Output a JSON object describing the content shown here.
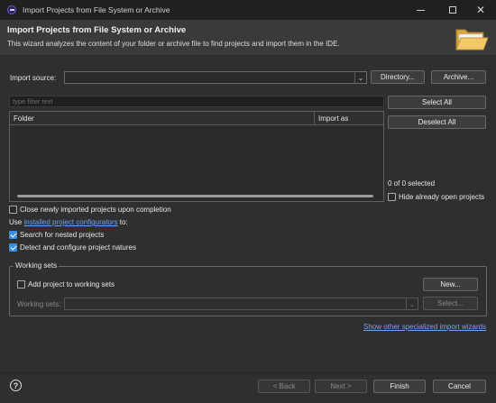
{
  "window": {
    "title": "Import Projects from File System or Archive",
    "icon": "eclipse-icon"
  },
  "header": {
    "title": "Import Projects from File System or Archive",
    "description": "This wizard analyzes the content of your folder or archive file to find projects and import them in the IDE.",
    "icon": "open-folder-icon"
  },
  "import_source": {
    "label": "Import source:",
    "value": "",
    "directory_button": "Directory...",
    "archive_button": "Archive..."
  },
  "filter": {
    "placeholder": "type filter text"
  },
  "table": {
    "columns": [
      "Folder",
      "Import as"
    ],
    "rows": []
  },
  "selection": {
    "select_all": "Select All",
    "deselect_all": "Deselect All",
    "count_text": "0 of 0 selected",
    "hide_open_label": "Hide already open projects",
    "hide_open_checked": false
  },
  "options": {
    "close_projects_label": "Close newly imported projects upon completion",
    "close_projects_checked": false,
    "configurators_prefix": "Use",
    "configurators_link": "installed project configurators",
    "configurators_suffix": "to:",
    "nested_label": "Search for nested projects",
    "nested_checked": true,
    "natures_label": "Detect and configure project natures",
    "natures_checked": true
  },
  "working_sets": {
    "legend": "Working sets",
    "add_label": "Add project to working sets",
    "add_checked": false,
    "new_button": "New...",
    "sets_label": "Working sets:",
    "select_button": "Select..."
  },
  "links": {
    "other_wizards": "Show other specialized import wizards"
  },
  "footer": {
    "back": "< Back",
    "next": "Next >",
    "finish": "Finish",
    "cancel": "Cancel"
  },
  "colors": {
    "accent": "#3b8fe0",
    "link": "#6aa6f8",
    "background": "#2f2f2f"
  }
}
